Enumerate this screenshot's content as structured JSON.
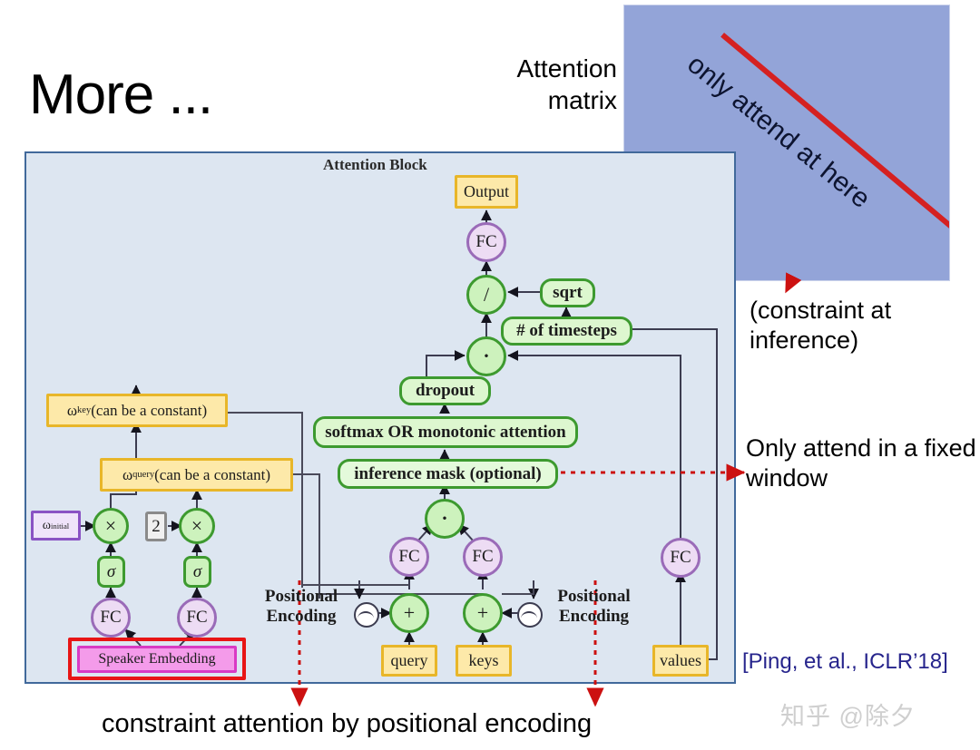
{
  "slide": {
    "title": "More ...",
    "bottom_caption": "constraint attention by positional encoding",
    "citation": "[Ping, et al., ICLR’18]",
    "watermark": "知乎 @除夕"
  },
  "attention_matrix": {
    "label": "Attention\nmatrix",
    "label_line1": "Attention",
    "label_line2": "matrix",
    "overlay_text": "only attend at here",
    "fill_color": "#93a4d8",
    "diagonal_color": "#d52121"
  },
  "annotations": {
    "constraint_inference": "(constraint at inference)",
    "fixed_window": "Only attend in a fixed window"
  },
  "diagram": {
    "title": "Attention Block",
    "frame_color": "#41699b",
    "frame_fill": "#dde6f1",
    "nodes": {
      "output": "Output",
      "fc_top": "FC",
      "divide": "/",
      "sqrt": "sqrt",
      "timesteps": "# of timesteps",
      "dot_upper": "·",
      "dropout": "dropout",
      "softmax": "softmax OR monotonic attention",
      "inference_mask": "inference mask (optional)",
      "dot_lower": "·",
      "fc_query": "FC",
      "fc_keys": "FC",
      "fc_values": "FC",
      "plus_query": "+",
      "plus_keys": "+",
      "query": "query",
      "keys": "keys",
      "values": "values",
      "omega_key": "ω",
      "omega_key_sub": "key",
      "omega_key_rest": " (can be a constant)",
      "omega_query": "ω",
      "omega_query_sub": "query",
      "omega_query_rest": " (can be a constant)",
      "omega_initial": "ω",
      "omega_initial_sub": "initial",
      "mult_left": "×",
      "mult_right": "×",
      "two": "2",
      "sigma_left": "σ",
      "sigma_right": "σ",
      "fc_left": "FC",
      "fc_right": "FC",
      "speaker_embedding": "Speaker Embedding",
      "positional_encoding_left": "Positional\nEncoding",
      "positional_encoding_left_l1": "Positional",
      "positional_encoding_left_l2": "Encoding",
      "positional_encoding_right_l1": "Positional",
      "positional_encoding_right_l2": "Encoding"
    }
  }
}
